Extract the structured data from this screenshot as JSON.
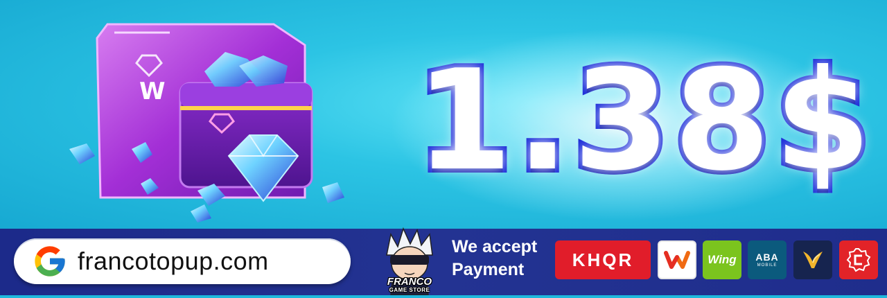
{
  "hero": {
    "price": "1.38$",
    "crate_letter": "W"
  },
  "footer": {
    "icon": "google-icon",
    "domain": "francotopup.com",
    "mascot": {
      "name": "FRANCO",
      "subtitle": "GAME STORE"
    },
    "accept_line1": "We accept",
    "accept_line2": "Payment",
    "payments": [
      {
        "name": "KHQR",
        "label": "KHQR",
        "color": "#e11d2a"
      },
      {
        "name": "wave-logo",
        "label": "",
        "color": "#ffffff"
      },
      {
        "name": "Wing",
        "label": "Wing",
        "color": "#7bc41e"
      },
      {
        "name": "ABA",
        "label": "ABA",
        "sub": "MOBILE",
        "color": "#0b5a7d"
      },
      {
        "name": "vattanac-logo",
        "label": "",
        "color": "#16244f"
      },
      {
        "name": "chip-logo",
        "label": "",
        "color": "#e22328"
      }
    ]
  },
  "colors": {
    "sky": "#1fb8dc",
    "bar": "#1c2a8a",
    "price_stroke": "#1628d8",
    "crate": "#b42fe0"
  }
}
